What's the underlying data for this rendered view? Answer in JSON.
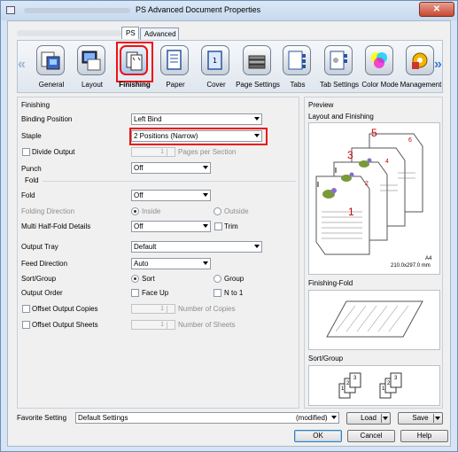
{
  "window": {
    "title": "PS Advanced Document Properties",
    "close_label": "✕"
  },
  "tabs": [
    {
      "label": "PS"
    },
    {
      "label": "Advanced"
    }
  ],
  "categories": [
    {
      "label": "General"
    },
    {
      "label": "Layout"
    },
    {
      "label": "Finishing"
    },
    {
      "label": "Paper"
    },
    {
      "label": "Cover"
    },
    {
      "label": "Page Settings"
    },
    {
      "label": "Tabs"
    },
    {
      "label": "Tab Settings"
    },
    {
      "label": "Color Mode"
    },
    {
      "label": "Management"
    }
  ],
  "finishing": {
    "section_label": "Finishing",
    "binding_position": {
      "label": "Binding Position",
      "value": "Left Bind"
    },
    "staple": {
      "label": "Staple",
      "value": "2 Positions (Narrow)"
    },
    "divide_output": {
      "label": "Divide Output",
      "value": "1",
      "unit": "Pages per Section"
    },
    "punch": {
      "label": "Punch",
      "value": "Off"
    },
    "fold_group_label": "Fold",
    "fold": {
      "label": "Fold",
      "value": "Off"
    },
    "folding_direction": {
      "label": "Folding Direction",
      "inside": "Inside",
      "outside": "Outside"
    },
    "multi_half_fold": {
      "label": "Multi Half-Fold Details",
      "value": "Off",
      "trim": "Trim"
    },
    "output_tray": {
      "label": "Output Tray",
      "value": "Default"
    },
    "feed_direction": {
      "label": "Feed Direction",
      "value": "Auto"
    },
    "sort_group": {
      "label": "Sort/Group",
      "sort": "Sort",
      "group": "Group"
    },
    "output_order": {
      "label": "Output Order",
      "face_up": "Face Up",
      "n_to_1": "N to 1"
    },
    "offset_copies": {
      "label": "Offset Output Copies",
      "value": "1",
      "unit": "Number of Copies"
    },
    "offset_sheets": {
      "label": "Offset Output Sheets",
      "value": "1",
      "unit": "Number of Sheets"
    }
  },
  "preview": {
    "section_label": "Preview",
    "layout_label": "Layout and Finishing",
    "paper_size": "A4",
    "paper_dims": "210.0x297.0 mm",
    "page_numbers": [
      "1",
      "2",
      "3",
      "4",
      "5",
      "6"
    ],
    "finishing_fold_label": "Finishing-Fold",
    "sort_group_label": "Sort/Group",
    "sort_digits": [
      "1",
      "2",
      "3",
      "1",
      "2",
      "3"
    ]
  },
  "footer": {
    "favorite_label": "Favorite Setting",
    "favorite_value": "Default Settings",
    "modified": "(modified)",
    "load": "Load",
    "save": "Save",
    "ok": "OK",
    "cancel": "Cancel",
    "help": "Help"
  },
  "colors": {
    "highlight": "#e11111",
    "accent": "#3a7bd5"
  }
}
